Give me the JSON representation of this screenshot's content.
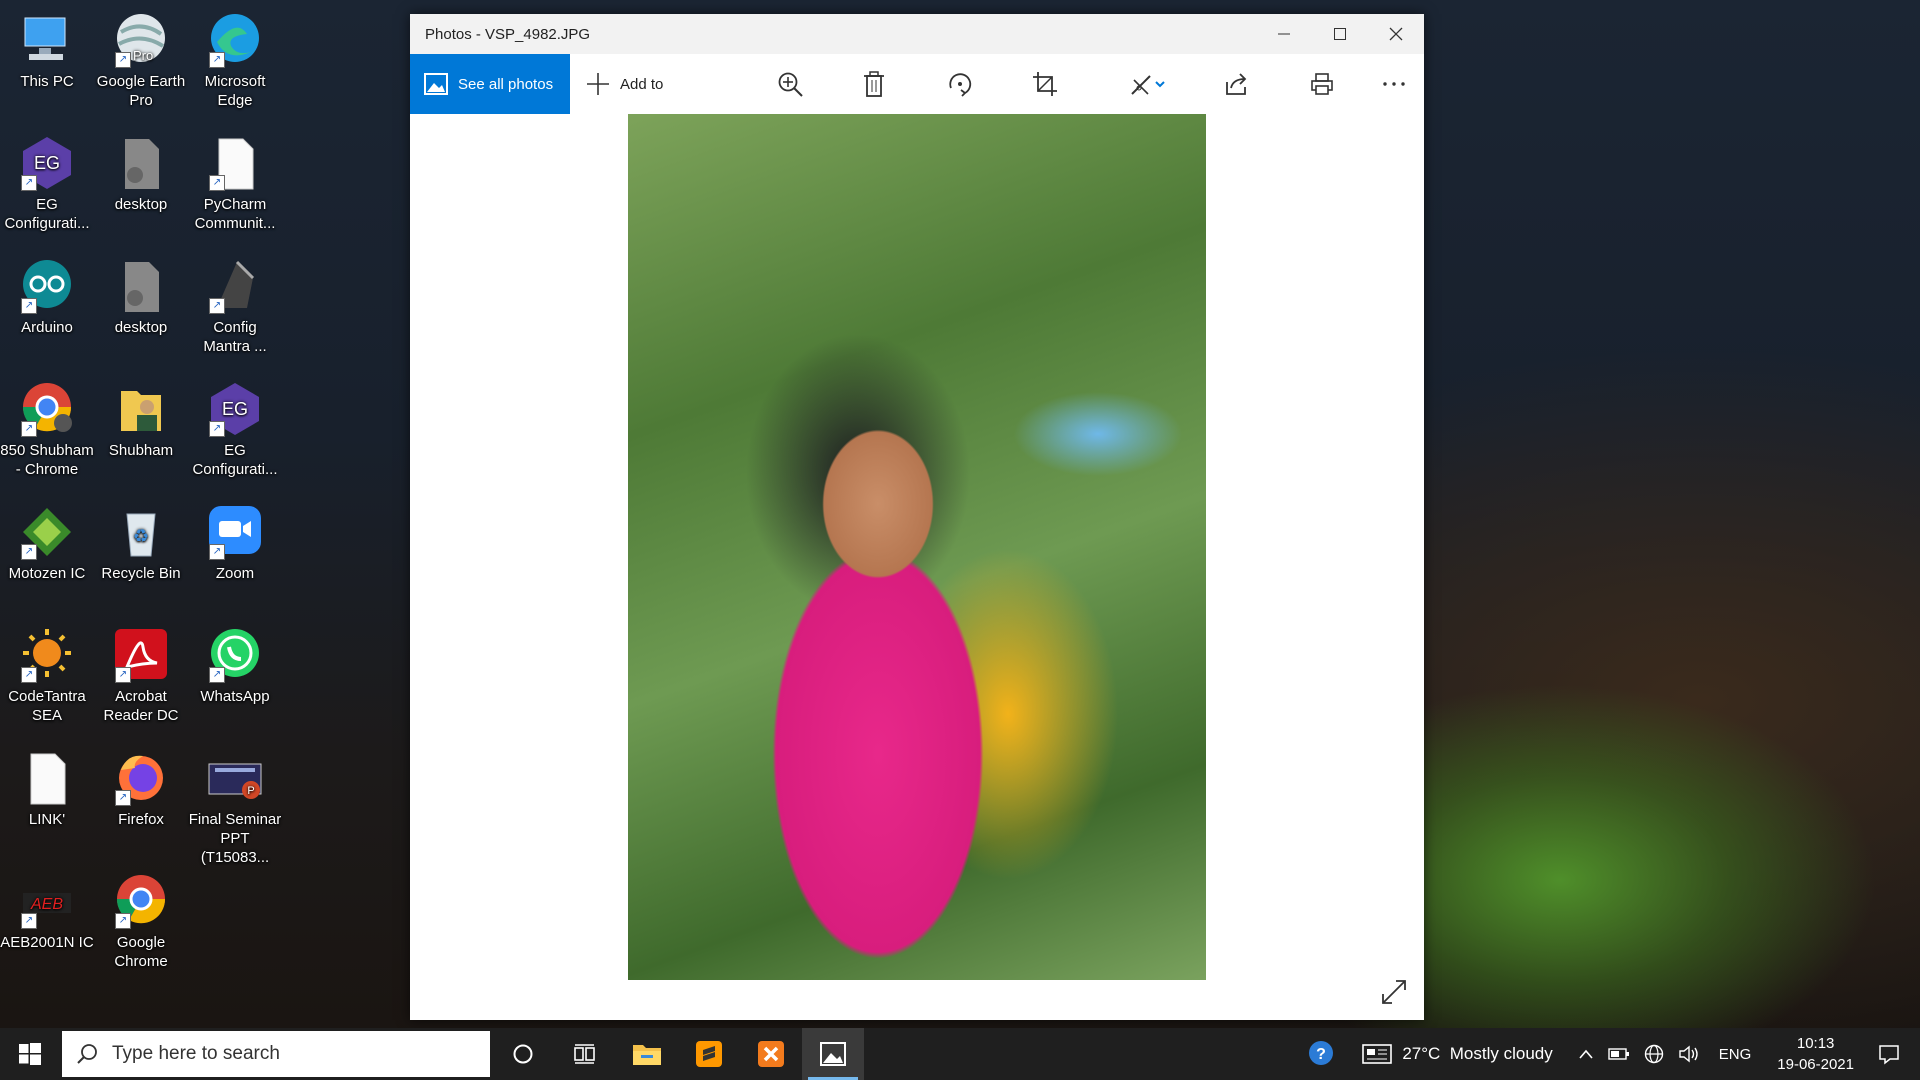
{
  "desktop": {
    "icons": [
      {
        "label": "This PC"
      },
      {
        "label": "Google Earth Pro",
        "badge": "Pro"
      },
      {
        "label": "Microsoft Edge"
      },
      {
        "label": "EG Configurati..."
      },
      {
        "label": "desktop"
      },
      {
        "label": "PyCharm Communit..."
      },
      {
        "label": "Arduino"
      },
      {
        "label": "desktop"
      },
      {
        "label": "Config Mantra ..."
      },
      {
        "label": "850 Shubham - Chrome"
      },
      {
        "label": "Shubham"
      },
      {
        "label": "EG Configurati..."
      },
      {
        "label": "Motozen IC"
      },
      {
        "label": "Recycle Bin"
      },
      {
        "label": "Zoom"
      },
      {
        "label": "CodeTantra SEA"
      },
      {
        "label": "Acrobat Reader DC"
      },
      {
        "label": "WhatsApp"
      },
      {
        "label": "LINK'"
      },
      {
        "label": "Firefox"
      },
      {
        "label": "Final Seminar PPT (T15083..."
      },
      {
        "label": "AEB2001N IC"
      },
      {
        "label": "Google Chrome"
      }
    ]
  },
  "window": {
    "title": "Photos - VSP_4982.JPG",
    "see_all_label": "See all photos",
    "add_to_label": "Add to"
  },
  "taskbar": {
    "search_placeholder": "Type here to search",
    "weather": "27°C  Mostly cloudy",
    "language": "ENG",
    "time": "10:13",
    "date": "19-06-2021"
  },
  "colors": {
    "accent": "#0078d7",
    "taskbar": "#1f1f1f"
  }
}
